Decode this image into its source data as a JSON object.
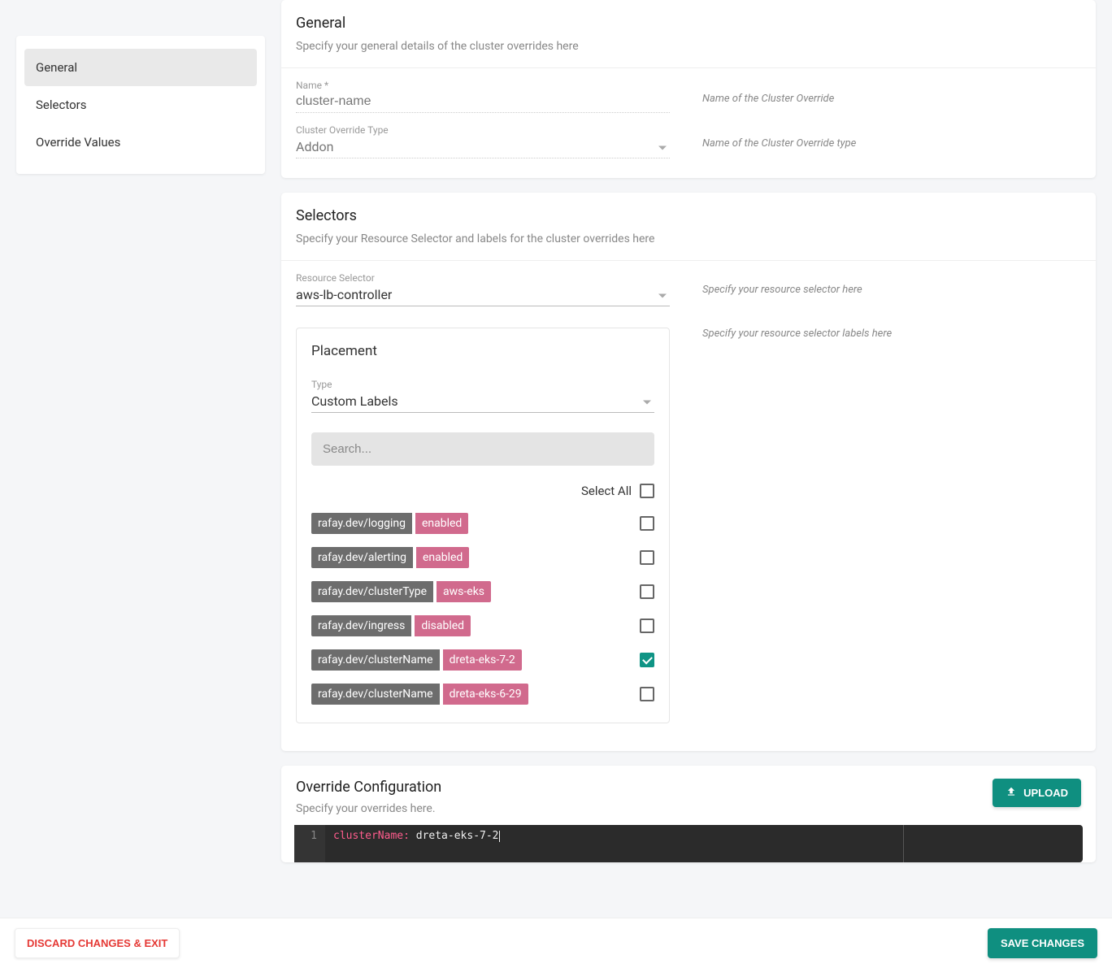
{
  "sidebar": {
    "items": [
      {
        "label": "General",
        "active": true
      },
      {
        "label": "Selectors",
        "active": false
      },
      {
        "label": "Override Values",
        "active": false
      }
    ]
  },
  "general": {
    "title": "General",
    "subtitle": "Specify your general details of the cluster overrides here",
    "name_label": "Name *",
    "name_value": "cluster-name",
    "name_hint": "Name of the Cluster Override",
    "type_label": "Cluster Override Type",
    "type_value": "Addon",
    "type_hint": "Name of the Cluster Override type"
  },
  "selectors": {
    "title": "Selectors",
    "subtitle": "Specify your Resource Selector and labels for the cluster overrides here",
    "resource_label": "Resource Selector",
    "resource_value": "aws-lb-controller",
    "resource_hint": "Specify your resource selector here",
    "labels_hint": "Specify your resource selector labels here",
    "placement": {
      "title": "Placement",
      "type_label": "Type",
      "type_value": "Custom Labels",
      "search_placeholder": "Search...",
      "select_all_label": "Select All",
      "select_all_checked": false,
      "labels": [
        {
          "key": "rafay.dev/logging",
          "value": "enabled",
          "checked": false
        },
        {
          "key": "rafay.dev/alerting",
          "value": "enabled",
          "checked": false
        },
        {
          "key": "rafay.dev/clusterType",
          "value": "aws-eks",
          "checked": false
        },
        {
          "key": "rafay.dev/ingress",
          "value": "disabled",
          "checked": false
        },
        {
          "key": "rafay.dev/clusterName",
          "value": "dreta-eks-7-2",
          "checked": true
        },
        {
          "key": "rafay.dev/clusterName",
          "value": "dreta-eks-6-29",
          "checked": false
        }
      ]
    }
  },
  "override": {
    "title": "Override Configuration",
    "subtitle": "Specify your overrides here.",
    "upload_label": "UPLOAD",
    "code": {
      "line_no": "1",
      "key": "clusterName:",
      "value": " dreta-eks-7-2"
    }
  },
  "footer": {
    "discard_label": "DISCARD CHANGES & EXIT",
    "save_label": "SAVE CHANGES"
  }
}
